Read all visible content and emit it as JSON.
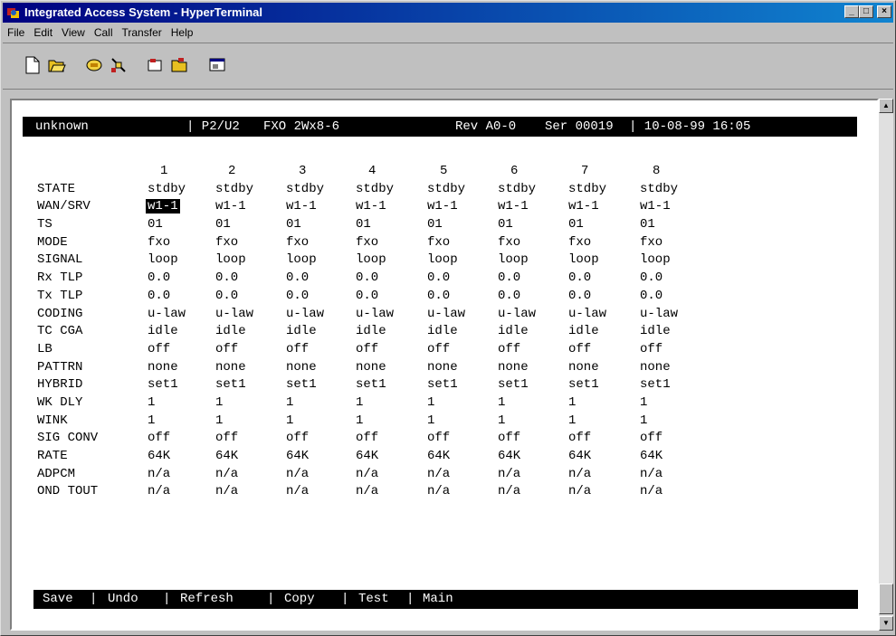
{
  "window": {
    "title": "Integrated Access System - HyperTerminal",
    "minimize": "_",
    "maximize": "□",
    "close": "×"
  },
  "menu": [
    "File",
    "Edit",
    "View",
    "Call",
    "Transfer",
    "Help"
  ],
  "toolbar": {
    "buttons": [
      "new-icon",
      "open-icon",
      "connect-icon",
      "disconnect-icon",
      "send-icon",
      "receive-icon",
      "properties-icon"
    ]
  },
  "status": {
    "node": "unknown",
    "slot": "| P2/U2",
    "card": "FXO 2Wx8-6",
    "rev": "Rev A0-0",
    "ser": "Ser 00019",
    "datetime": "| 10-08-99 16:05"
  },
  "ports": [
    "1",
    "2",
    "3",
    "4",
    "5",
    "6",
    "7",
    "8"
  ],
  "rows": [
    {
      "label": "STATE",
      "values": [
        "stdby",
        "stdby",
        "stdby",
        "stdby",
        "stdby",
        "stdby",
        "stdby",
        "stdby"
      ]
    },
    {
      "label": "WAN/SRV",
      "values": [
        "w1-1",
        "w1-1",
        "w1-1",
        "w1-1",
        "w1-1",
        "w1-1",
        "w1-1",
        "w1-1"
      ]
    },
    {
      "label": "TS",
      "values": [
        "01",
        "01",
        "01",
        "01",
        "01",
        "01",
        "01",
        "01"
      ]
    },
    {
      "label": "MODE",
      "values": [
        "fxo",
        "fxo",
        "fxo",
        "fxo",
        "fxo",
        "fxo",
        "fxo",
        "fxo"
      ]
    },
    {
      "label": "SIGNAL",
      "values": [
        "loop",
        "loop",
        "loop",
        "loop",
        "loop",
        "loop",
        "loop",
        "loop"
      ]
    },
    {
      "label": "Rx TLP",
      "values": [
        "0.0",
        "0.0",
        "0.0",
        "0.0",
        "0.0",
        "0.0",
        "0.0",
        "0.0"
      ]
    },
    {
      "label": "Tx TLP",
      "values": [
        "0.0",
        "0.0",
        "0.0",
        "0.0",
        "0.0",
        "0.0",
        "0.0",
        "0.0"
      ]
    },
    {
      "label": "CODING",
      "values": [
        "u-law",
        "u-law",
        "u-law",
        "u-law",
        "u-law",
        "u-law",
        "u-law",
        "u-law"
      ]
    },
    {
      "label": "TC CGA",
      "values": [
        "idle",
        "idle",
        "idle",
        "idle",
        "idle",
        "idle",
        "idle",
        "idle"
      ]
    },
    {
      "label": "LB",
      "values": [
        "off",
        "off",
        "off",
        "off",
        "off",
        "off",
        "off",
        "off"
      ]
    },
    {
      "label": "PATTRN",
      "values": [
        "none",
        "none",
        "none",
        "none",
        "none",
        "none",
        "none",
        "none"
      ]
    },
    {
      "label": "HYBRID",
      "values": [
        "set1",
        "set1",
        "set1",
        "set1",
        "set1",
        "set1",
        "set1",
        "set1"
      ]
    },
    {
      "label": "WK DLY",
      "values": [
        "1",
        "1",
        "1",
        "1",
        "1",
        "1",
        "1",
        "1"
      ]
    },
    {
      "label": "WINK",
      "values": [
        "1",
        "1",
        "1",
        "1",
        "1",
        "1",
        "1",
        "1"
      ]
    },
    {
      "label": "SIG CONV",
      "values": [
        "off",
        "off",
        "off",
        "off",
        "off",
        "off",
        "off",
        "off"
      ]
    },
    {
      "label": "RATE",
      "values": [
        "64K",
        "64K",
        "64K",
        "64K",
        "64K",
        "64K",
        "64K",
        "64K"
      ]
    },
    {
      "label": "ADPCM",
      "values": [
        "n/a",
        "n/a",
        "n/a",
        "n/a",
        "n/a",
        "n/a",
        "n/a",
        "n/a"
      ]
    },
    {
      "label": "OND TOUT",
      "values": [
        "n/a",
        "n/a",
        "n/a",
        "n/a",
        "n/a",
        "n/a",
        "n/a",
        "n/a"
      ]
    }
  ],
  "selected_cell": {
    "row": 1,
    "col": 0
  },
  "commands": [
    "Save",
    "Undo",
    "Refresh",
    "Copy",
    "Test",
    "Main"
  ],
  "command_separator": "|"
}
